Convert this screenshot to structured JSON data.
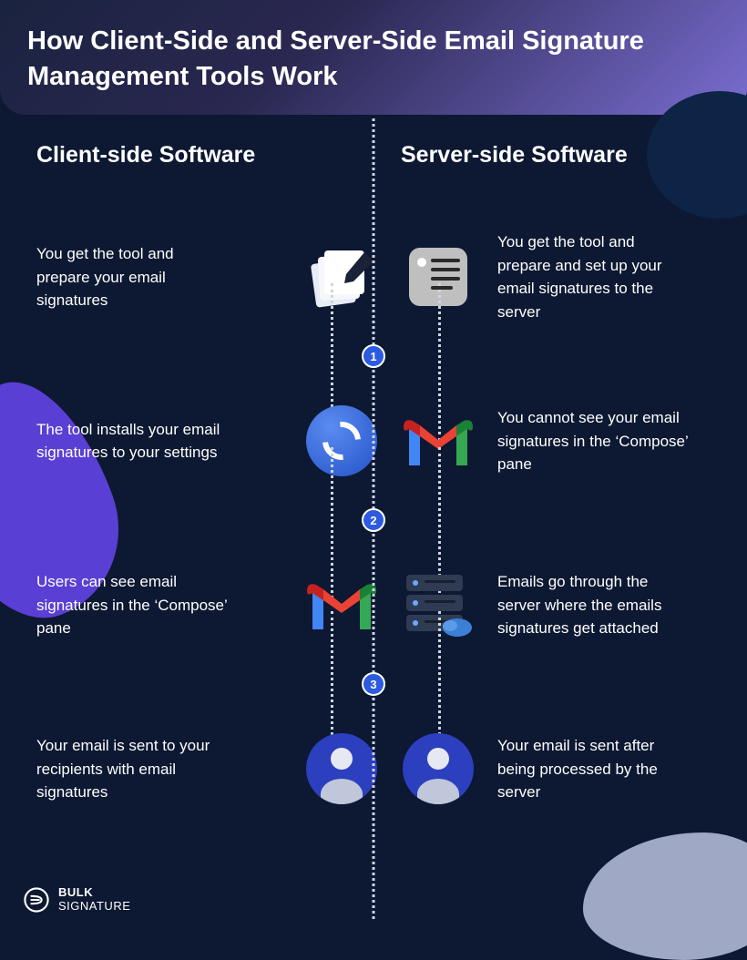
{
  "header": {
    "title": "How Client-Side and Server-Side Email Signature Management Tools Work"
  },
  "left": {
    "heading": "Client-side Software",
    "steps": [
      {
        "text": "You get the tool and prepare your email signatures",
        "icon": "document-pen"
      },
      {
        "text": "The tool installs your email signatures to your settings",
        "icon": "sync"
      },
      {
        "text": "Users can see email signatures in the ‘Compose’ pane",
        "icon": "gmail"
      },
      {
        "text": "Your email is sent to your recipients with email signatures",
        "icon": "user"
      }
    ]
  },
  "right": {
    "heading": "Server-side Software",
    "steps": [
      {
        "text": "You get the tool and prepare and set up your email signatures to the server",
        "icon": "note"
      },
      {
        "text": "You cannot see your email signatures in the ‘Compose’ pane",
        "icon": "gmail"
      },
      {
        "text": "Emails go through the server where the emails signatures get attached",
        "icon": "server"
      },
      {
        "text": "Your email is sent after being processed by the server",
        "icon": "user"
      }
    ]
  },
  "badges": [
    "1",
    "2",
    "3"
  ],
  "logo": {
    "line1": "BULK",
    "line2": "SIGNATURE"
  }
}
